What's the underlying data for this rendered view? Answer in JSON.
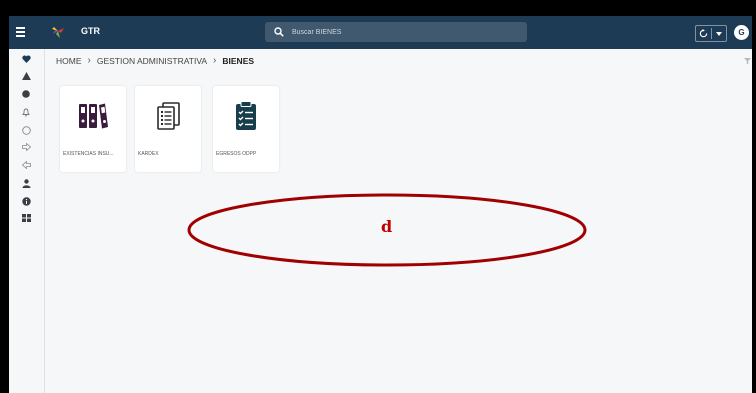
{
  "header": {
    "app_title": "GTR",
    "search_placeholder": "Buscar BIENES",
    "avatar_initial": "G"
  },
  "sidebar": {
    "items": [
      {
        "icon": "heart-icon"
      },
      {
        "icon": "triangle-icon"
      },
      {
        "icon": "circle-filled-icon"
      },
      {
        "icon": "bell-icon"
      },
      {
        "icon": "circle-outline-icon"
      },
      {
        "icon": "arrow-right-icon"
      },
      {
        "icon": "arrow-left-icon"
      },
      {
        "icon": "user-icon"
      },
      {
        "icon": "info-icon"
      },
      {
        "icon": "grid-icon"
      }
    ]
  },
  "breadcrumb": {
    "items": [
      "HOME",
      "GESTION ADMINISTRATIVA",
      "BIENES"
    ],
    "separator": "›"
  },
  "tiles": [
    {
      "label": "EXISTENCIAS INSU...",
      "icon": "binders-icon",
      "color": "#3a1a3d"
    },
    {
      "label": "KARDEX",
      "icon": "document-list-icon",
      "color": "#2b2b2b"
    },
    {
      "label": "EGRESOS ODPP",
      "icon": "clipboard-checklist-icon",
      "color": "#183d4d"
    }
  ],
  "annotation": {
    "label": "d",
    "color": "#a00000"
  },
  "colors": {
    "topbar": "#1d3b55",
    "background": "#f6f7f9"
  }
}
